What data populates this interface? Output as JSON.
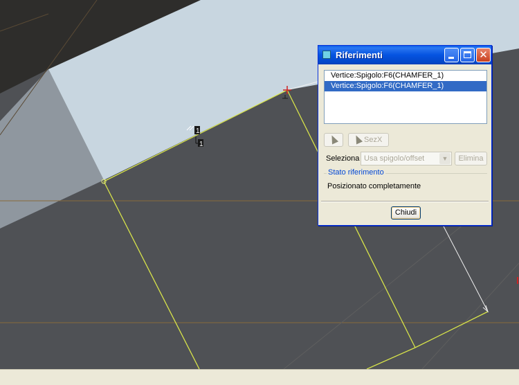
{
  "dialog": {
    "title": "Riferimenti",
    "references": [
      {
        "label": "Vertice:Spigolo:F6(CHAMFER_1)",
        "selected": false
      },
      {
        "label": "Vertice:Spigolo:F6(CHAMFER_1)",
        "selected": true
      }
    ],
    "pick_icon": "arrow-cursor-icon",
    "sez_button_label": "SezX",
    "seleziona_label": "Seleziona",
    "seleziona_value": "Usa spigolo/offset",
    "elimina_label": "Elimina",
    "stato_group_label": "Stato riferimento",
    "stato_value": "Posizionato completamente",
    "close_label": "Chiudi"
  },
  "viewport": {
    "annotation_label": "1",
    "colors": {
      "background": "#4f5155",
      "face_light": "#c8d6e0",
      "face_dark": "#2e2d2b",
      "edge_highlight": "#d8e44a",
      "datum_line": "#b07a3a",
      "vertex_marker": "#cc2222"
    }
  },
  "theme": {
    "title_blue": "#0553e0",
    "selection_blue": "#316ac5",
    "dialog_face": "#ece9d8"
  }
}
